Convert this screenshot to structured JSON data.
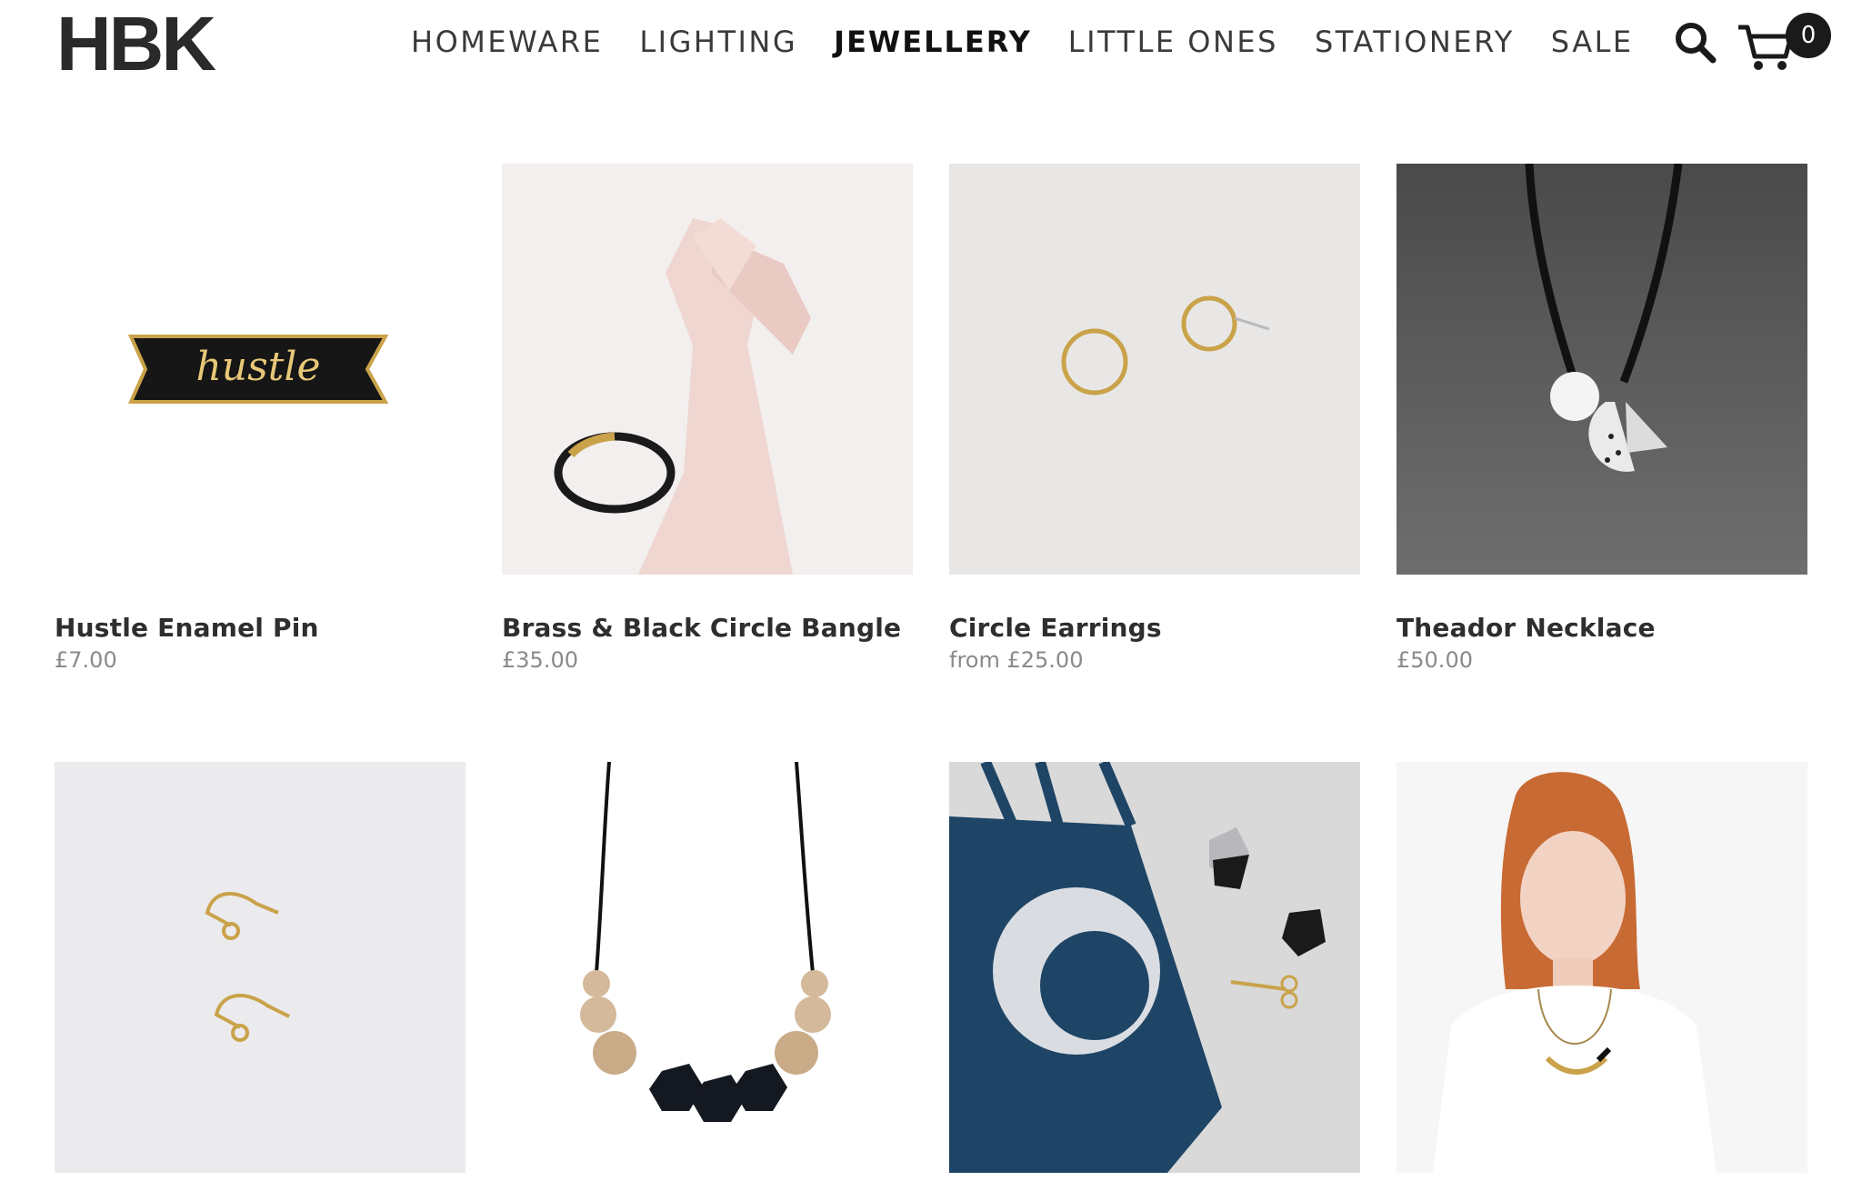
{
  "header": {
    "logo": "HBK",
    "nav": [
      {
        "label": "HOMEWARE"
      },
      {
        "label": "LIGHTING"
      },
      {
        "label": "JEWELLERY",
        "active": true
      },
      {
        "label": "LITTLE ONES"
      },
      {
        "label": "STATIONERY"
      },
      {
        "label": "SALE"
      }
    ],
    "search_icon": "search-icon",
    "cart_icon": "cart-icon",
    "cart_count": "0"
  },
  "products": [
    {
      "name": "Hustle Enamel Pin",
      "price": "£7.00",
      "pin_text": "hustle"
    },
    {
      "name": "Brass & Black Circle Bangle",
      "price": "£35.00"
    },
    {
      "name": "Circle Earrings",
      "price": "from £25.00"
    },
    {
      "name": "Theador Necklace",
      "price": "£50.00"
    },
    {
      "name": "",
      "price": ""
    },
    {
      "name": "",
      "price": ""
    },
    {
      "name": "",
      "price": ""
    },
    {
      "name": "",
      "price": ""
    }
  ],
  "colors": {
    "text": "#2e2e2e",
    "price": "#8a8a8a",
    "accent": "#1a1a1a",
    "brass": "#c9a24a",
    "tote_navy": "#1f4566"
  }
}
